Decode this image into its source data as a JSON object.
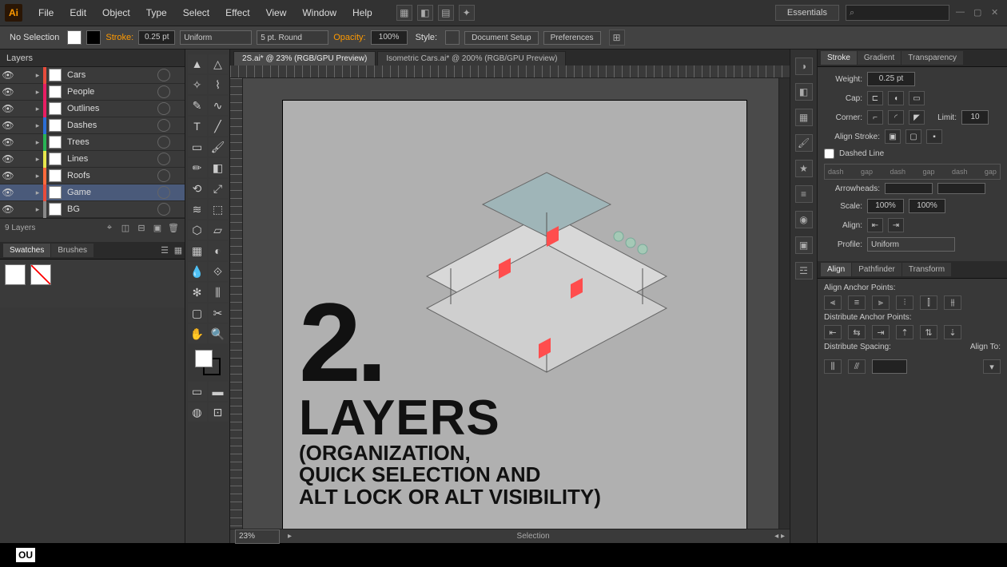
{
  "titlebar": {
    "logo": "Ai",
    "menu": [
      "File",
      "Edit",
      "Object",
      "Type",
      "Select",
      "Effect",
      "View",
      "Window",
      "Help"
    ],
    "workspace": "Essentials",
    "search_placeholder": "⌕"
  },
  "options": {
    "selection": "No Selection",
    "stroke_label": "Stroke:",
    "stroke_weight": "0.25 pt",
    "stroke_style": "Uniform",
    "brush_def": "5 pt. Round",
    "opacity_label": "Opacity:",
    "opacity_value": "100%",
    "style_label": "Style:",
    "doc_setup": "Document Setup",
    "preferences": "Preferences"
  },
  "layers": {
    "panel_title": "Layers",
    "items": [
      {
        "name": "Cars",
        "color": "#e74c3c"
      },
      {
        "name": "People",
        "color": "#e91e63"
      },
      {
        "name": "Outlines",
        "color": "#e91e63"
      },
      {
        "name": "Dashes",
        "color": "#2c6ed5"
      },
      {
        "name": "Trees",
        "color": "#29b455"
      },
      {
        "name": "Lines",
        "color": "#e7e74c"
      },
      {
        "name": "Roofs",
        "color": "#ff6a3c"
      },
      {
        "name": "Game",
        "color": "#e74c3c",
        "selected": true
      },
      {
        "name": "BG",
        "color": "#888"
      }
    ],
    "footer_count": "9 Layers"
  },
  "swatches": {
    "tab1": "Swatches",
    "tab2": "Brushes"
  },
  "doc_tabs": [
    {
      "label": "2S.ai* @ 23% (RGB/GPU Preview)",
      "active": true
    },
    {
      "label": "Isometric Cars.ai* @ 200% (RGB/GPU Preview)",
      "active": false
    }
  ],
  "overlay": {
    "number": "2.",
    "title": "LAYERS",
    "sub1": "(ORGANIZATION,",
    "sub2": "QUICK SELECTION AND",
    "sub3": "ALT LOCK OR ALT VISIBILITY)"
  },
  "status": {
    "zoom": "23%",
    "mode": "Selection"
  },
  "stroke_panel": {
    "tabs": [
      "Stroke",
      "Gradient",
      "Transparency"
    ],
    "weight_label": "Weight:",
    "weight_value": "0.25 pt",
    "cap_label": "Cap:",
    "corner_label": "Corner:",
    "limit_label": "Limit:",
    "limit_value": "10",
    "align_label": "Align Stroke:",
    "dashed_label": "Dashed Line",
    "dash_cols": [
      "dash",
      "gap",
      "dash",
      "gap",
      "dash",
      "gap"
    ],
    "arrow_label": "Arrowheads:",
    "scale_label": "Scale:",
    "scale_val1": "100%",
    "scale_val2": "100%",
    "align_arrow": "Align:",
    "profile_label": "Profile:",
    "profile_value": "Uniform"
  },
  "align_panel": {
    "tabs": [
      "Align",
      "Pathfinder",
      "Transform"
    ],
    "row1": "Align Anchor Points:",
    "row2": "Distribute Anchor Points:",
    "row3": "Distribute Spacing:",
    "alignto": "Align To:"
  },
  "brand": "OU"
}
